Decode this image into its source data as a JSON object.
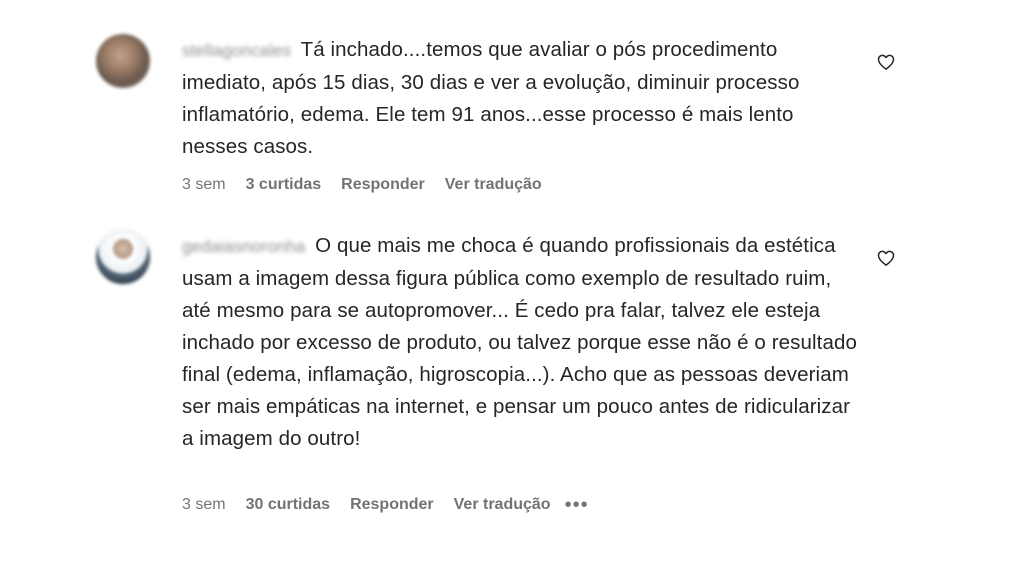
{
  "comments": [
    {
      "username": "stellagoncales",
      "text": "Tá inchado....temos que avaliar o pós procedimento imediato, após 15 dias, 30 dias e ver a evolução, diminuir processo inflamatório, edema. Ele tem 91 anos...esse processo é mais lento nesses casos.",
      "time": "3 sem",
      "likes": "3 curtidas",
      "reply": "Responder",
      "translate": "Ver tradução",
      "like_icon": "heart-outline-icon"
    },
    {
      "username": "gedaiasnoronha",
      "text": "O que mais me choca é quando profissionais da estética usam a imagem dessa figura pública como exemplo de resultado ruim, até mesmo para se autopromover... É cedo pra falar, talvez ele esteja inchado por excesso de produto, ou talvez porque esse não é o resultado final (edema, inflamação, higroscopia...). Acho que as pessoas deveriam ser mais empáticas na internet, e pensar um pouco antes de ridicularizar a imagem do outro!",
      "time": "3 sem",
      "likes": "30 curtidas",
      "reply": "Responder",
      "translate": "Ver tradução",
      "more": "•••",
      "like_icon": "heart-outline-icon"
    }
  ],
  "colors": {
    "text": "#262626",
    "secondary": "#737373",
    "background": "#ffffff"
  }
}
